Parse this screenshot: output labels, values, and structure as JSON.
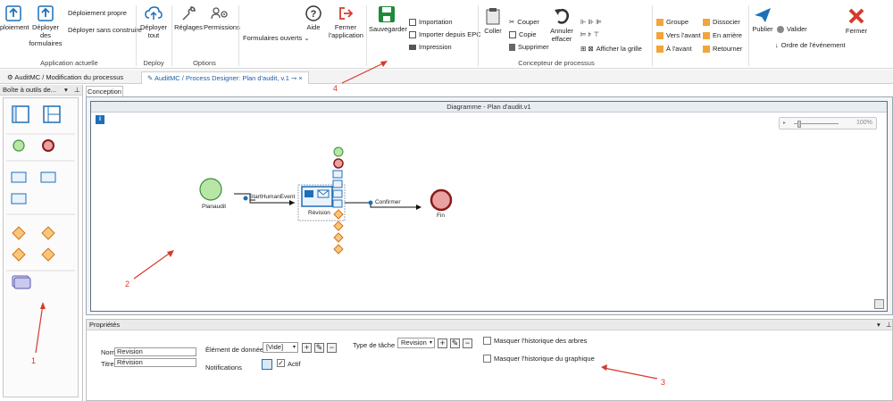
{
  "ribbon": {
    "groups": {
      "app_current": "Application actuelle",
      "deploy": "Deploy",
      "options": "Options",
      "designer": "Concepteur de processus"
    },
    "buttons": {
      "deploy_partial": "ploiement",
      "deploy_forms": "Déployer des formulaires",
      "deploy_clean": "Déploiement propre",
      "deploy_no_build": "Déployer sans construire",
      "deploy_all": "Déployer tout",
      "settings": "Réglages",
      "permissions": "Permissions",
      "open_forms": "Formulaires ouverts",
      "help": "Aide",
      "close_app": "Fermer l'application",
      "save": "Sauvegarder",
      "import": "Importation",
      "import_epc": "Importer depuis EPC",
      "print": "Impression",
      "paste": "Coller",
      "cut": "Couper",
      "copy": "Copie",
      "delete": "Supprimer",
      "undo": "Annuler effacer",
      "show_grid": "Afficher la grille",
      "group": "Groupe",
      "ungroup": "Dissocier",
      "bring_forward": "Vers l'avant",
      "send_back": "En arrière",
      "to_front": "À l'avant",
      "back_out": "Retourner",
      "publish": "Publier",
      "validate": "Valider",
      "event_order": "Ordre de l'événement",
      "close": "Fermer"
    }
  },
  "doc_tabs": [
    {
      "label": "AuditMC / Modification du processus"
    },
    {
      "label": "AuditMC / Process Designer: Plan d'audit, v.1"
    }
  ],
  "toolbox": {
    "title": "Boîte à outils de..."
  },
  "designer": {
    "tab": "Conception",
    "canvas_title": "Diagramme - Plan d'audit.v1",
    "zoom": "100%",
    "nodes": {
      "start": "Planaudit",
      "task": "Révision",
      "end": "Fin",
      "flow1": "StartHumanEvent",
      "flow2": "Confirmer"
    }
  },
  "properties": {
    "title": "Propriétés",
    "name_label": "Nom",
    "name_value": "Revision",
    "title_label": "Titre",
    "title_value": "Révision",
    "data_element_label": "Élément de données",
    "data_element_value": "[Vide]",
    "notifications_label": "Notifications",
    "active_label": "Actif",
    "task_type_label": "Type de tâche",
    "task_type_value": "Revision",
    "hide_tree_history": "Masquer l'historique des arbres",
    "hide_graph_history": "Masquer l'historique du graphique"
  },
  "annotations": [
    "1",
    "2",
    "3",
    "4"
  ],
  "colors": {
    "accent_blue": "#1d6fb8",
    "save_green": "#1e8a3a",
    "close_red": "#d63a2c",
    "orange": "#f2a53a",
    "annotation_red": "#d63a2c",
    "start_event": "#b7e6a5",
    "end_event": "#e9a1a1"
  }
}
